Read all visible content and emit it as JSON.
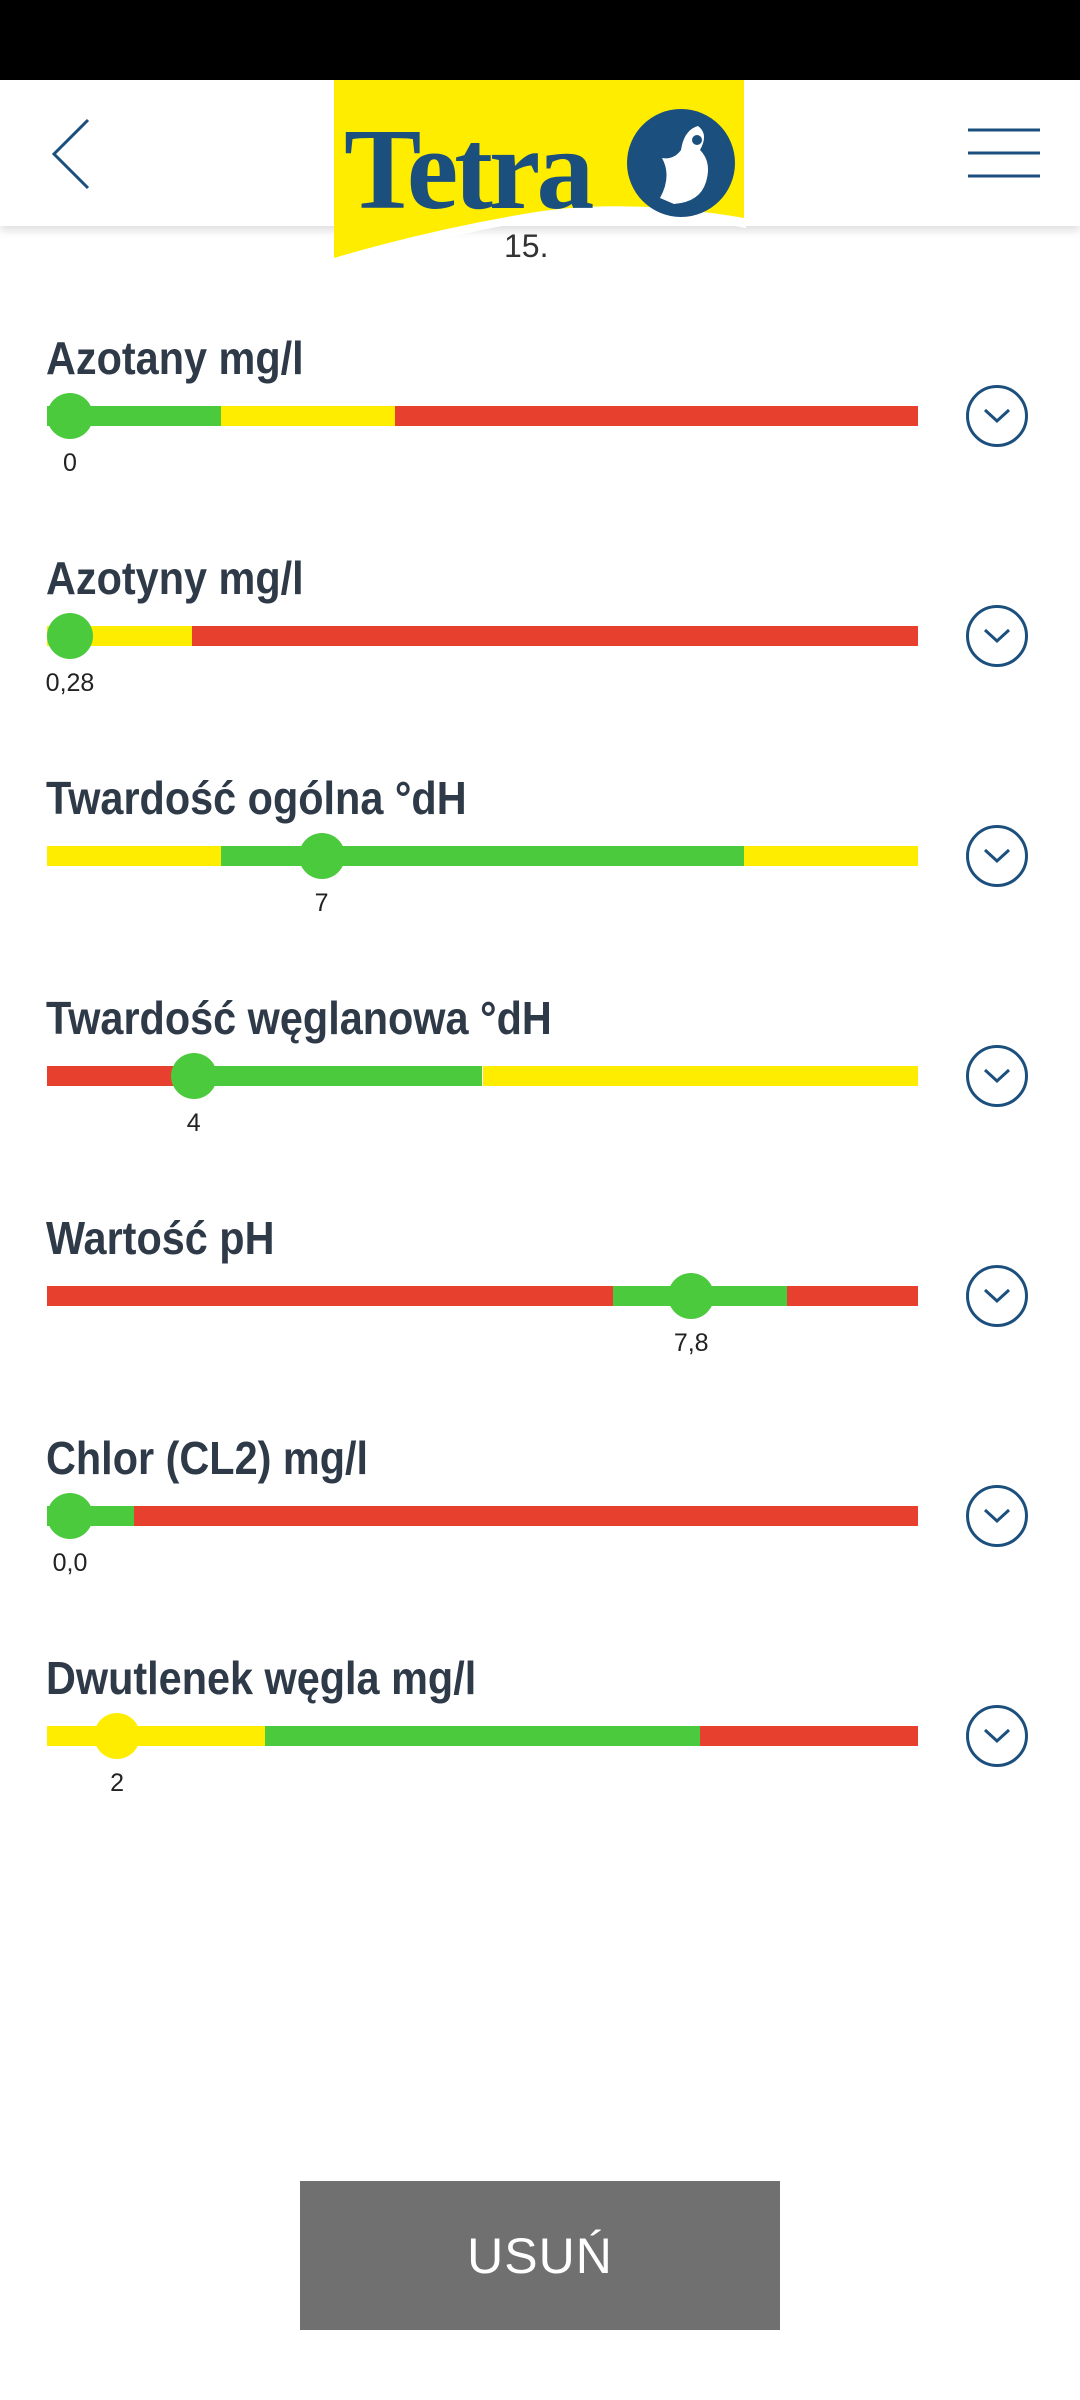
{
  "header": {
    "logo_text": "Tetra",
    "back_icon": "chevron-left-icon",
    "menu_icon": "hamburger-menu-icon"
  },
  "scroll_peek_text": "15.",
  "colors": {
    "green": "#4cca3d",
    "yellow": "#ffed00",
    "red": "#e8402e",
    "navy": "#1b4f7e",
    "title": "#2f3a48"
  },
  "parameters": [
    {
      "title": "Azotany mg/l",
      "value_label": "0",
      "thumb_position": 0.0,
      "thumb_color": "green",
      "segments": [
        {
          "color": "green",
          "start": 0.0,
          "end": 0.2
        },
        {
          "color": "yellow",
          "start": 0.2,
          "end": 0.4
        },
        {
          "color": "red",
          "start": 0.4,
          "end": 1.0
        }
      ]
    },
    {
      "title": "Azotyny mg/l",
      "value_label": "0,28",
      "thumb_position": 0.0,
      "thumb_color": "green",
      "segments": [
        {
          "color": "yellow",
          "start": 0.0,
          "end": 0.167
        },
        {
          "color": "red",
          "start": 0.167,
          "end": 1.0
        }
      ]
    },
    {
      "title": "Twardość ogólna °dH",
      "value_label": "7",
      "thumb_position": 0.305,
      "thumb_color": "green",
      "segments": [
        {
          "color": "yellow",
          "start": 0.0,
          "end": 0.2
        },
        {
          "color": "green",
          "start": 0.2,
          "end": 0.8
        },
        {
          "color": "yellow",
          "start": 0.8,
          "end": 1.0
        }
      ]
    },
    {
      "title": "Twardość węglanowa °dH",
      "value_label": "4",
      "thumb_position": 0.15,
      "thumb_color": "green",
      "segments": [
        {
          "color": "red",
          "start": 0.0,
          "end": 0.15
        },
        {
          "color": "green",
          "start": 0.15,
          "end": 0.5
        },
        {
          "color": "yellow",
          "start": 0.5,
          "end": 1.0
        }
      ]
    },
    {
      "title": "Wartość pH",
      "value_label": "7,8",
      "thumb_position": 0.753,
      "thumb_color": "green",
      "segments": [
        {
          "color": "red",
          "start": 0.0,
          "end": 0.65
        },
        {
          "color": "green",
          "start": 0.65,
          "end": 0.85
        },
        {
          "color": "red",
          "start": 0.85,
          "end": 1.0
        }
      ]
    },
    {
      "title": "Chlor (CL2) mg/l",
      "value_label": "0,0",
      "thumb_position": 0.0,
      "thumb_color": "green",
      "segments": [
        {
          "color": "green",
          "start": 0.0,
          "end": 0.1
        },
        {
          "color": "red",
          "start": 0.1,
          "end": 1.0
        }
      ]
    },
    {
      "title": "Dwutlenek węgla mg/l",
      "value_label": "2",
      "thumb_position": 0.057,
      "thumb_color": "yellow",
      "segments": [
        {
          "color": "yellow",
          "start": 0.0,
          "end": 0.25
        },
        {
          "color": "green",
          "start": 0.25,
          "end": 0.75
        },
        {
          "color": "red",
          "start": 0.75,
          "end": 1.0
        }
      ]
    }
  ],
  "delete_button": {
    "label": "USUŃ"
  }
}
